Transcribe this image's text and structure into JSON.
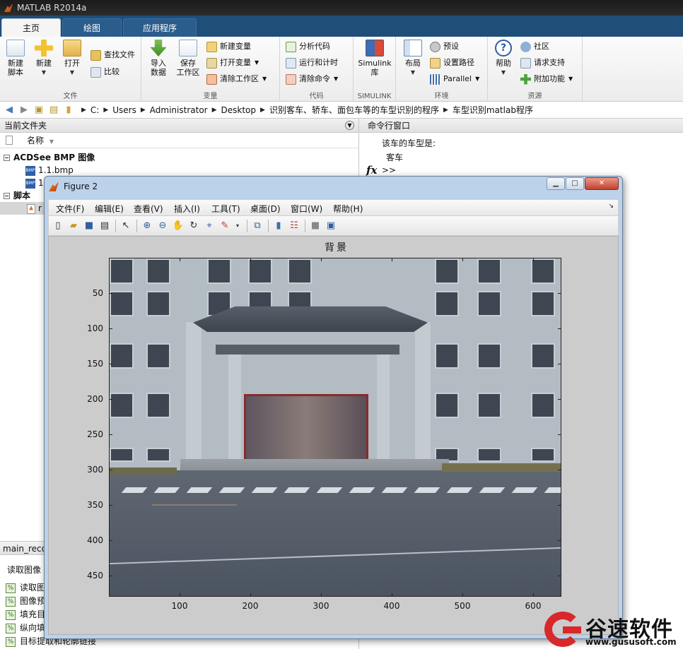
{
  "app": {
    "title": "MATLAB R2014a"
  },
  "tabs": [
    "主页",
    "绘图",
    "应用程序"
  ],
  "ribbon": {
    "file": {
      "label": "文件",
      "new_script": "新建\n脚本",
      "new": "新建",
      "open": "打开",
      "find_files": "查找文件",
      "compare": "比较"
    },
    "variable": {
      "label": "变量",
      "import": "导入\n数据",
      "save_ws": "保存\n工作区",
      "new_var": "新建变量",
      "open_var": "打开变量",
      "clear_ws": "清除工作区"
    },
    "code": {
      "label": "代码",
      "analyze": "分析代码",
      "run_time": "运行和计时",
      "clear_cmd": "清除命令"
    },
    "simulink": {
      "label": "SIMULINK",
      "lib": "Simulink\n库"
    },
    "env": {
      "label": "环境",
      "layout": "布局",
      "prefs": "预设",
      "set_path": "设置路径",
      "parallel": "Parallel"
    },
    "resources": {
      "label": "资源",
      "help": "帮助",
      "community": "社区",
      "support": "请求支持",
      "addons": "附加功能"
    }
  },
  "address": {
    "path": [
      "C:",
      "Users",
      "Administrator",
      "Desktop",
      "识别客车、轿车、面包车等的车型识别的程序",
      "车型识别matlab程序"
    ]
  },
  "current_folder": {
    "title": "当前文件夹",
    "col_name": "名称",
    "group_bmp": "ACDSee BMP 图像",
    "file1": "1.1.bmp",
    "file2": "1",
    "group_script": "脚本",
    "script1": "r"
  },
  "details": {
    "head": "main_reco",
    "title": "读取图像",
    "items": [
      "读取图",
      "图像预",
      "填充目",
      "纵向填",
      "目标提取和轮廓链接"
    ]
  },
  "command_window": {
    "title": "命令行窗口",
    "line1": "该车的车型是:",
    "line2": "客车",
    "prompt": ">>"
  },
  "figure": {
    "title": "Figure 2",
    "menus": [
      "文件(F)",
      "编辑(E)",
      "查看(V)",
      "插入(I)",
      "工具(T)",
      "桌面(D)",
      "窗口(W)",
      "帮助(H)"
    ],
    "axes_title": "背景",
    "yticks": [
      "50",
      "100",
      "150",
      "200",
      "250",
      "300",
      "350",
      "400",
      "450"
    ],
    "xticks": [
      "100",
      "200",
      "300",
      "400",
      "500",
      "600"
    ]
  },
  "watermark": {
    "name": "谷速软件",
    "url": "www.gususoft.com"
  },
  "colors": {
    "tab_bar": "#1f4e79",
    "accent_red": "#d8282b"
  }
}
